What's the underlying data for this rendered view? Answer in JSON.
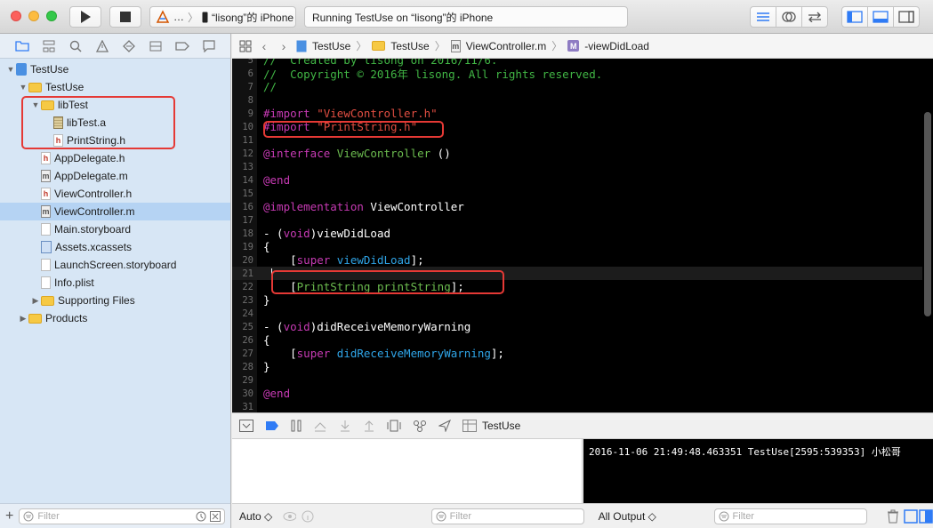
{
  "toolbar": {
    "scheme_prefix": "…",
    "scheme_device": "“lisong”的 iPhone",
    "status": "Running TestUse on “lisong”的 iPhone"
  },
  "navigator": {
    "filter_placeholder": "Filter",
    "tree": [
      {
        "label": "TestUse",
        "level": 0,
        "icon": "project",
        "disclosure": "open"
      },
      {
        "label": "TestUse",
        "level": 1,
        "icon": "folder",
        "disclosure": "open"
      },
      {
        "label": "libTest",
        "level": 2,
        "icon": "folder",
        "disclosure": "open"
      },
      {
        "label": "libTest.a",
        "level": 3,
        "icon": "lib"
      },
      {
        "label": "PrintString.h",
        "level": 3,
        "icon": "h"
      },
      {
        "label": "AppDelegate.h",
        "level": 2,
        "icon": "h"
      },
      {
        "label": "AppDelegate.m",
        "level": 2,
        "icon": "m"
      },
      {
        "label": "ViewController.h",
        "level": 2,
        "icon": "h"
      },
      {
        "label": "ViewController.m",
        "level": 2,
        "icon": "m",
        "selected": true
      },
      {
        "label": "Main.storyboard",
        "level": 2,
        "icon": "storyboard"
      },
      {
        "label": "Assets.xcassets",
        "level": 2,
        "icon": "assets"
      },
      {
        "label": "LaunchScreen.storyboard",
        "level": 2,
        "icon": "storyboard"
      },
      {
        "label": "Info.plist",
        "level": 2,
        "icon": "plist"
      },
      {
        "label": "Supporting Files",
        "level": 2,
        "icon": "folder",
        "disclosure": "closed"
      },
      {
        "label": "Products",
        "level": 1,
        "icon": "folder",
        "disclosure": "closed"
      }
    ]
  },
  "jumpbar": {
    "project": "TestUse",
    "group": "TestUse",
    "file": "ViewController.m",
    "symbol_badge": "M",
    "symbol": "-viewDidLoad"
  },
  "editor": {
    "lines": [
      {
        "n": "5",
        "tokens": [
          [
            "c-comment",
            "//  Created by lisong on 2016/11/6."
          ]
        ]
      },
      {
        "n": "6",
        "tokens": [
          [
            "c-comment",
            "//  Copyright © 2016年 lisong. All rights reserved."
          ]
        ]
      },
      {
        "n": "7",
        "tokens": [
          [
            "c-comment",
            "//"
          ]
        ]
      },
      {
        "n": "8",
        "tokens": []
      },
      {
        "n": "9",
        "tokens": [
          [
            "c-kw",
            "#import "
          ],
          [
            "c-str",
            "\"ViewController.h\""
          ]
        ]
      },
      {
        "n": "10",
        "tokens": [
          [
            "c-kw",
            "#import "
          ],
          [
            "c-str",
            "\"PrintString.h\""
          ]
        ]
      },
      {
        "n": "11",
        "tokens": []
      },
      {
        "n": "12",
        "tokens": [
          [
            "c-kw",
            "@interface "
          ],
          [
            "c-class",
            "ViewController"
          ],
          [
            "",
            " ()"
          ]
        ]
      },
      {
        "n": "13",
        "tokens": []
      },
      {
        "n": "14",
        "tokens": [
          [
            "c-kw",
            "@end"
          ]
        ]
      },
      {
        "n": "15",
        "tokens": []
      },
      {
        "n": "16",
        "tokens": [
          [
            "c-kw",
            "@implementation "
          ],
          [
            "",
            "ViewController"
          ]
        ]
      },
      {
        "n": "17",
        "tokens": []
      },
      {
        "n": "18",
        "tokens": [
          [
            "",
            "- ("
          ],
          [
            "c-kw",
            "void"
          ],
          [
            "",
            ")viewDidLoad"
          ]
        ]
      },
      {
        "n": "19",
        "tokens": [
          [
            "",
            "{"
          ]
        ]
      },
      {
        "n": "20",
        "tokens": [
          [
            "",
            "    ["
          ],
          [
            "c-kw",
            "super "
          ],
          [
            "c-method",
            "viewDidLoad"
          ],
          [
            "",
            "];"
          ]
        ]
      },
      {
        "n": "21",
        "tokens": [
          [
            "",
            "    "
          ]
        ],
        "current": true
      },
      {
        "n": "22",
        "tokens": [
          [
            "",
            "    ["
          ],
          [
            "c-class",
            "PrintString "
          ],
          [
            "c-class",
            "printString"
          ],
          [
            "",
            "];"
          ]
        ]
      },
      {
        "n": "23",
        "tokens": [
          [
            "",
            "}"
          ]
        ]
      },
      {
        "n": "24",
        "tokens": []
      },
      {
        "n": "25",
        "tokens": [
          [
            "",
            "- ("
          ],
          [
            "c-kw",
            "void"
          ],
          [
            "",
            ")didReceiveMemoryWarning"
          ]
        ]
      },
      {
        "n": "26",
        "tokens": [
          [
            "",
            "{"
          ]
        ]
      },
      {
        "n": "27",
        "tokens": [
          [
            "",
            "    ["
          ],
          [
            "c-kw",
            "super "
          ],
          [
            "c-method",
            "didReceiveMemoryWarning"
          ],
          [
            "",
            "];"
          ]
        ]
      },
      {
        "n": "28",
        "tokens": [
          [
            "",
            "}"
          ]
        ]
      },
      {
        "n": "29",
        "tokens": []
      },
      {
        "n": "30",
        "tokens": [
          [
            "c-kw",
            "@end"
          ]
        ]
      },
      {
        "n": "31",
        "tokens": []
      }
    ]
  },
  "debug": {
    "target": "TestUse",
    "variables_mode": "Auto ◇",
    "variables_filter": "Filter",
    "console_mode": "All Output ◇",
    "console_filter": "Filter",
    "console_output": "2016-11-06 21:49:48.463351 TestUse[2595:539353] 小松哥"
  },
  "colors": {
    "highlight_box": "#e53935",
    "selection": "#b5d3f3",
    "comment": "#41b645",
    "keyword": "#c73ab4",
    "string": "#e24e42"
  }
}
